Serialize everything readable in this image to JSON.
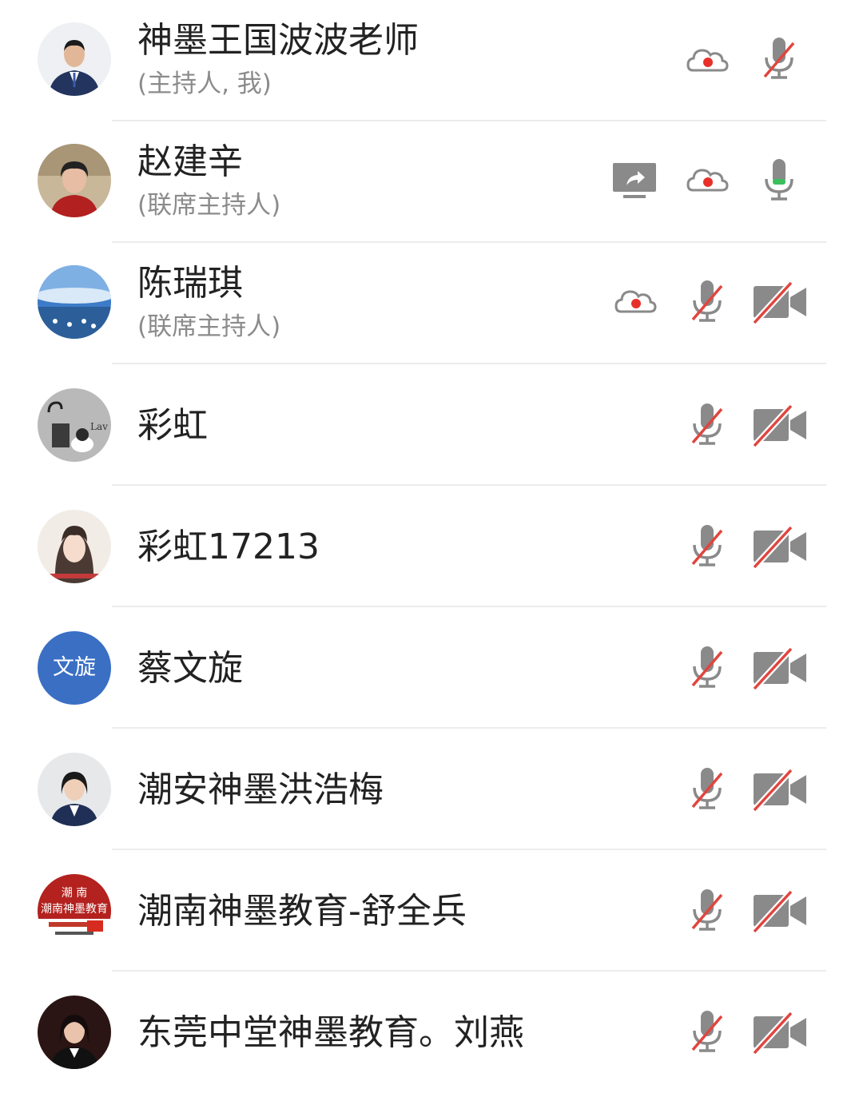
{
  "participants": [
    {
      "name": "神墨王国波波老师",
      "role": "(主持人, 我)",
      "avatar": "photo-man-suit",
      "icons": [
        "cloud-record-icon",
        "mic-muted-icon"
      ]
    },
    {
      "name": "赵建辛",
      "role": "(联席主持人)",
      "avatar": "photo-woman-short-hair",
      "icons": [
        "screen-share-icon",
        "cloud-record-icon",
        "mic-on-icon"
      ]
    },
    {
      "name": "陈瑞琪",
      "role": "(联席主持人)",
      "avatar": "photo-seaside",
      "icons": [
        "cloud-record-icon",
        "mic-muted-icon",
        "camera-off-icon"
      ]
    },
    {
      "name": "彩虹",
      "role": "",
      "avatar": "photo-cartoon-wall",
      "icons": [
        "mic-muted-icon",
        "camera-off-icon"
      ]
    },
    {
      "name": "彩虹17213",
      "role": "",
      "avatar": "photo-anime-girl",
      "icons": [
        "mic-muted-icon",
        "camera-off-icon"
      ]
    },
    {
      "name": "蔡文旋",
      "role": "",
      "avatar": "text-avatar",
      "avatar_text": "文旋",
      "icons": [
        "mic-muted-icon",
        "camera-off-icon"
      ]
    },
    {
      "name": "潮安神墨洪浩梅",
      "role": "",
      "avatar": "photo-woman-suit",
      "icons": [
        "mic-muted-icon",
        "camera-off-icon"
      ]
    },
    {
      "name": "潮南神墨教育-舒全兵",
      "role": "",
      "avatar": "logo-red-badge",
      "logo_text": "潮南神墨教育",
      "icons": [
        "mic-muted-icon",
        "camera-off-icon"
      ]
    },
    {
      "name": "东莞中堂神墨教育。刘燕",
      "role": "",
      "avatar": "photo-woman-dark",
      "icons": [
        "mic-muted-icon",
        "camera-off-icon"
      ]
    }
  ],
  "colors": {
    "mute_slash": "#e0453f",
    "icon_gray": "#8a8a8a",
    "record_dot": "#e8302a",
    "mic_green": "#3bbf5c",
    "avatar_blue": "#3a6fc4"
  }
}
